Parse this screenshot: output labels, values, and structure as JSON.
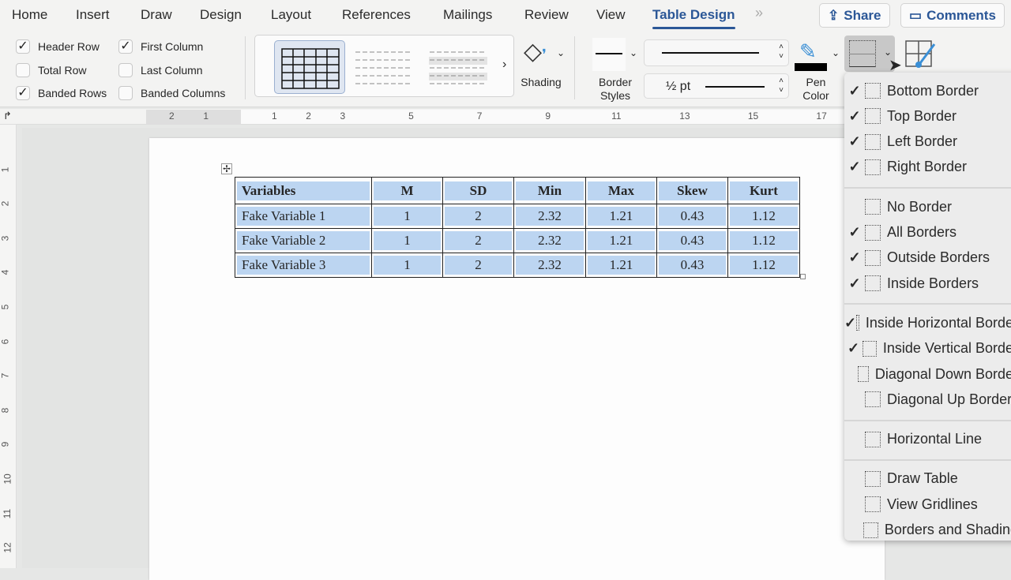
{
  "tabs": [
    "Home",
    "Insert",
    "Draw",
    "Design",
    "Layout",
    "References",
    "Mailings",
    "Review",
    "View",
    "Table Design"
  ],
  "active_tab": "Table Design",
  "more": "»",
  "share": "Share",
  "comments": "Comments",
  "style_options": [
    {
      "label": "Header Row",
      "checked": true
    },
    {
      "label": "Total Row",
      "checked": false
    },
    {
      "label": "Banded Rows",
      "checked": true
    },
    {
      "label": "First Column",
      "checked": true
    },
    {
      "label": "Last Column",
      "checked": false
    },
    {
      "label": "Banded Columns",
      "checked": false
    }
  ],
  "shading": "Shading",
  "border_styles": "Border Styles",
  "pen_weight": "½ pt",
  "pen_color_label": "Pen Color",
  "pen_color": "#000000",
  "accent": "#2b5797",
  "ruler_h": [
    -2,
    -1,
    1,
    2,
    3,
    5,
    7,
    9,
    11,
    13,
    15,
    17
  ],
  "ruler_v": [
    1,
    2,
    3,
    4,
    5,
    6,
    7,
    8,
    9,
    10,
    11,
    12
  ],
  "table": {
    "headers": [
      "Variables",
      "M",
      "SD",
      "Min",
      "Max",
      "Skew",
      "Kurt"
    ],
    "rows": [
      [
        "Fake Variable 1",
        "1",
        "2",
        "2.32",
        "1.21",
        "0.43",
        "1.12"
      ],
      [
        "Fake Variable 2",
        "1",
        "2",
        "2.32",
        "1.21",
        "0.43",
        "1.12"
      ],
      [
        "Fake Variable 3",
        "1",
        "2",
        "2.32",
        "1.21",
        "0.43",
        "1.12"
      ]
    ],
    "band_color": "#bcd5f1"
  },
  "menu": [
    {
      "label": "Bottom Border",
      "checked": true,
      "icon": "bottom-border-icon"
    },
    {
      "label": "Top Border",
      "checked": true,
      "icon": "top-border-icon"
    },
    {
      "label": "Left Border",
      "checked": true,
      "icon": "left-border-icon"
    },
    {
      "label": "Right Border",
      "checked": true,
      "icon": "right-border-icon"
    },
    {
      "sep": true
    },
    {
      "label": "No Border",
      "checked": false,
      "icon": "no-border-icon"
    },
    {
      "label": "All Borders",
      "checked": true,
      "icon": "all-borders-icon"
    },
    {
      "label": "Outside Borders",
      "checked": true,
      "icon": "outside-borders-icon"
    },
    {
      "label": "Inside Borders",
      "checked": true,
      "icon": "inside-borders-icon"
    },
    {
      "sep": true
    },
    {
      "label": "Inside Horizontal Border",
      "checked": true,
      "icon": "inside-horizontal-border-icon"
    },
    {
      "label": "Inside Vertical Border",
      "checked": true,
      "icon": "inside-vertical-border-icon"
    },
    {
      "label": "Diagonal Down Border",
      "checked": false,
      "icon": "diagonal-down-border-icon"
    },
    {
      "label": "Diagonal Up Border",
      "checked": false,
      "icon": "diagonal-up-border-icon"
    },
    {
      "sep": true
    },
    {
      "label": "Horizontal Line",
      "checked": false,
      "icon": "horizontal-line-icon"
    },
    {
      "sep": true
    },
    {
      "label": "Draw Table",
      "checked": false,
      "icon": "draw-table-icon"
    },
    {
      "label": "View Gridlines",
      "checked": false,
      "icon": "view-gridlines-icon"
    },
    {
      "label": "Borders and Shading",
      "checked": false,
      "icon": "borders-and-shading-icon"
    }
  ]
}
